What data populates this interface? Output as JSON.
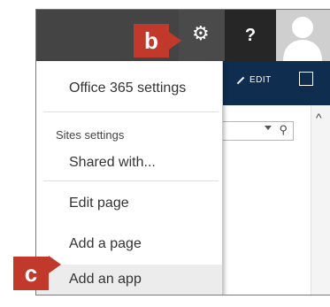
{
  "annotations": {
    "b": "b",
    "c": "c"
  },
  "topbar": {
    "gear_icon": "⚙",
    "help_label": "?"
  },
  "commandbar": {
    "edit_label": "EDIT"
  },
  "menu": {
    "office_settings": "Office 365 settings",
    "section_heading": "Sites settings",
    "items": [
      "Shared with...",
      "Edit page",
      "Add a page",
      "Add an app"
    ]
  },
  "colors": {
    "badge": "#c0392b",
    "commandbar": "#0e2d4f",
    "topbar": "#444444"
  }
}
